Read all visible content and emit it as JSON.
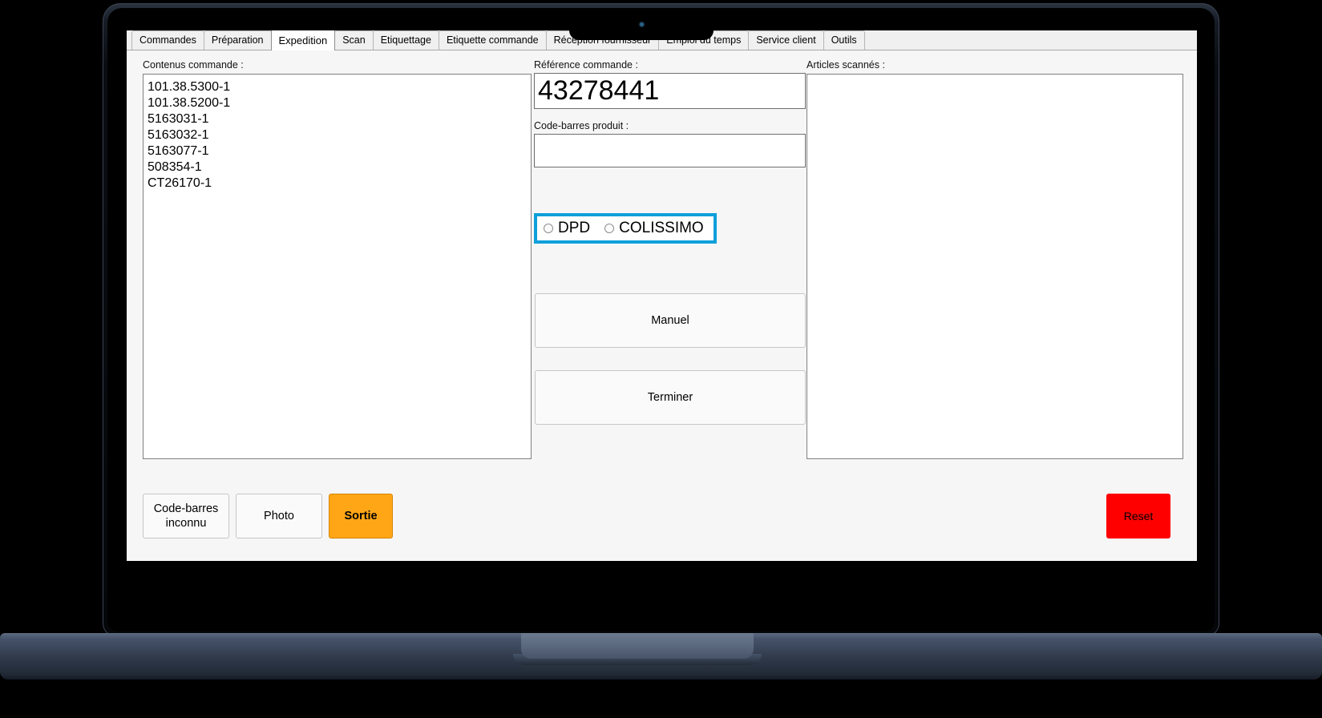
{
  "device": {
    "type": "laptop",
    "camera": "camera-dot"
  },
  "tabs": [
    {
      "label": "Commandes",
      "active": false
    },
    {
      "label": "Préparation",
      "active": false
    },
    {
      "label": "Expedition",
      "active": true
    },
    {
      "label": "Scan",
      "active": false
    },
    {
      "label": "Etiquettage",
      "active": false
    },
    {
      "label": "Etiquette commande",
      "active": false
    },
    {
      "label": "Réception fournisseur",
      "active": false
    },
    {
      "label": "Emploi du temps",
      "active": false
    },
    {
      "label": "Service client",
      "active": false
    },
    {
      "label": "Outils",
      "active": false
    }
  ],
  "left_panel": {
    "label": "Contenus commande :",
    "items": [
      "101.38.5300-1",
      "101.38.5200-1",
      "5163031-1",
      "5163032-1",
      "5163077-1",
      "508354-1",
      "CT26170-1"
    ]
  },
  "middle_panel": {
    "reference": {
      "label": "Référence commande :",
      "value": "43278441",
      "placeholder": ""
    },
    "barcode": {
      "label": "Code-barres produit :",
      "value": "",
      "placeholder": ""
    },
    "carrier": {
      "highlighted": true,
      "highlight_color": "#0f9fdb",
      "options": [
        {
          "label": "DPD",
          "selected": false
        },
        {
          "label": "COLISSIMO",
          "selected": false
        }
      ]
    },
    "manual_button": "Manuel",
    "finish_button": "Terminer"
  },
  "right_panel": {
    "label": "Articles scannés :",
    "items": []
  },
  "bottom_bar": {
    "unknown_barcode_button": "Code-barres\ninconnu",
    "unknown_barcode_line1": "Code-barres",
    "unknown_barcode_line2": "inconnu",
    "photo_button": "Photo",
    "exit_button": "Sortie",
    "exit_color": "#ffa617",
    "reset_button": "Reset",
    "reset_color": "#ff0000"
  }
}
